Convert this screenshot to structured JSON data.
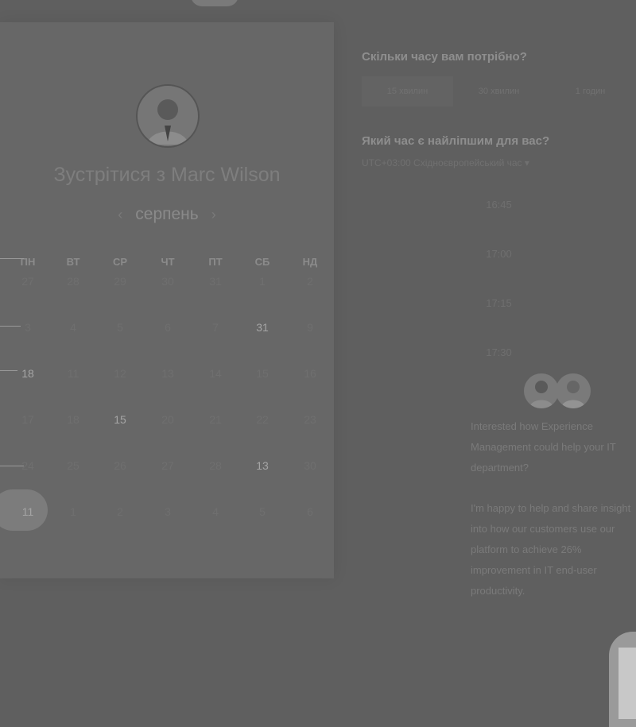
{
  "host": {
    "title": "Зустрітися з Marc Wilson"
  },
  "calendar": {
    "month": "серпень",
    "prev_label": "‹",
    "next_label": "›",
    "weekdays": [
      "ПН",
      "ВТ",
      "СР",
      "ЧТ",
      "ПТ",
      "СБ",
      "НД"
    ],
    "weeks": [
      [
        "27",
        "28",
        "29",
        "30",
        "31",
        "1",
        "2"
      ],
      [
        "3",
        "4",
        "5",
        "6",
        "7",
        "31",
        "9"
      ],
      [
        "18",
        "11",
        "12",
        "13",
        "14",
        "15",
        "16"
      ],
      [
        "17",
        "18",
        "15",
        "20",
        "21",
        "22",
        "23"
      ],
      [
        "24",
        "25",
        "26",
        "27",
        "28",
        "13",
        "30"
      ],
      [
        "11",
        "1",
        "2",
        "3",
        "4",
        "5",
        "6"
      ]
    ],
    "highlighted": [
      {
        "week": 1,
        "day": 5
      },
      {
        "week": 2,
        "day": 0
      },
      {
        "week": 3,
        "day": 2
      },
      {
        "week": 4,
        "day": 5
      },
      {
        "week": 5,
        "day": 0
      }
    ]
  },
  "duration": {
    "heading": "Скільки часу вам потрібно?",
    "options": [
      "15 хвилин",
      "30 хвилин",
      "1 годин"
    ],
    "selected": "15 хвилин"
  },
  "time": {
    "heading": "Який час є найліпшим для вас?",
    "timezone": "UTC+03:00 Східноєвропейський час ▾",
    "slots": [
      "16:45",
      "17:00",
      "17:15",
      "17:30"
    ]
  },
  "bio": {
    "paragraph1": "Interested how Experience Management could help your IT department?",
    "paragraph2": "I'm happy to help and share insight into how our customers use our platform to achieve 26% improvement in IT end-user productivity."
  },
  "colors": {
    "overlay": "#5f5f5f",
    "card": "#676767",
    "selected_day": "#7c7c7c"
  }
}
